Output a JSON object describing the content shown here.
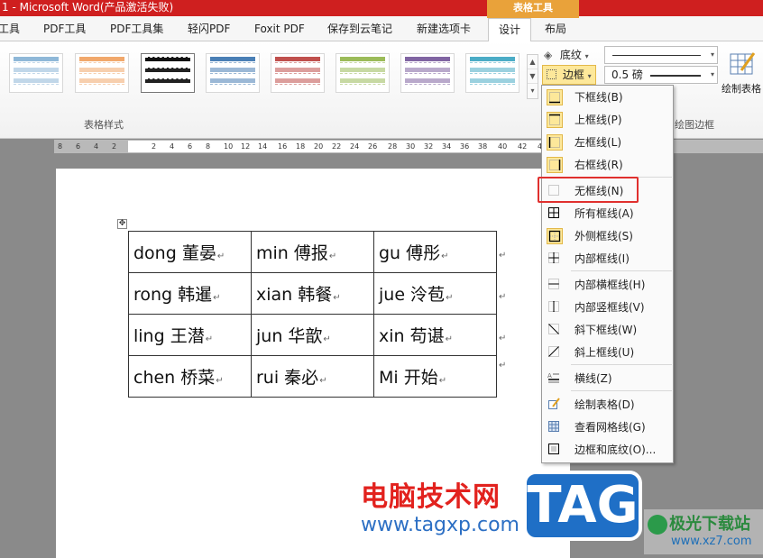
{
  "title": "1 - Microsoft Word(产品激活失败)",
  "context_tab_group": "表格工具",
  "tabs": [
    {
      "label": "工具"
    },
    {
      "label": "PDF工具"
    },
    {
      "label": "PDF工具集"
    },
    {
      "label": "轻闪PDF"
    },
    {
      "label": "Foxit PDF"
    },
    {
      "label": "保存到云笔记"
    },
    {
      "label": "新建选项卡"
    },
    {
      "label": "设计",
      "active": true
    },
    {
      "label": "布局"
    }
  ],
  "ribbon": {
    "table_styles_group": "表格样式",
    "draw_borders_group": "绘图边框",
    "shading_label": "底纹",
    "borders_label": "边框",
    "line_weight": "0.5 磅",
    "draw_table_label": "绘制表格",
    "gallery_arrows": [
      "▲",
      "▼",
      "▾"
    ],
    "style_colors": [
      "#8fb8d8",
      "#f1a86c",
      "#111111",
      "#4a7fb5",
      "#c0504d",
      "#9bbb59",
      "#8064a2",
      "#4bacc6"
    ]
  },
  "ruler": {
    "numbers": [
      "8",
      "6",
      "4",
      "2",
      "2",
      "4",
      "6",
      "8",
      "10",
      "12",
      "14",
      "16",
      "18",
      "20",
      "22",
      "24",
      "26",
      "28",
      "30",
      "32",
      "34",
      "36",
      "38",
      "40",
      "42",
      "44"
    ]
  },
  "document": {
    "anchor_glyph": "✥",
    "cell_mark": "↵",
    "table": [
      [
        "dong 董晏",
        "min 傅报",
        "gu 傅彤"
      ],
      [
        "rong 韩暹",
        "xian 韩餐",
        "jue 泠苞"
      ],
      [
        "ling 王潜",
        "jun 华歆",
        "xin 苟谌"
      ],
      [
        "chen 桥菜",
        "rui 秦必",
        "Mi 开始"
      ]
    ]
  },
  "border_menu": {
    "items": [
      {
        "label": "下框线(B)",
        "icon": "bottom-border-icon"
      },
      {
        "label": "上框线(P)",
        "icon": "top-border-icon"
      },
      {
        "label": "左框线(L)",
        "icon": "left-border-icon"
      },
      {
        "label": "右框线(R)",
        "icon": "right-border-icon"
      },
      {
        "label": "无框线(N)",
        "icon": "no-border-icon"
      },
      {
        "label": "所有框线(A)",
        "icon": "all-borders-icon"
      },
      {
        "label": "外侧框线(S)",
        "icon": "outside-borders-icon"
      },
      {
        "label": "内部框线(I)",
        "icon": "inside-borders-icon"
      },
      {
        "label": "内部横框线(H)",
        "icon": "inside-horizontal-border-icon"
      },
      {
        "label": "内部竖框线(V)",
        "icon": "inside-vertical-border-icon"
      },
      {
        "label": "斜下框线(W)",
        "icon": "diagonal-down-border-icon"
      },
      {
        "label": "斜上框线(U)",
        "icon": "diagonal-up-border-icon"
      },
      {
        "label": "横线(Z)",
        "icon": "horizontal-line-icon"
      },
      {
        "label": "绘制表格(D)",
        "icon": "draw-table-icon"
      },
      {
        "label": "查看网格线(G)",
        "icon": "view-gridlines-icon"
      },
      {
        "label": "边框和底纹(O)...",
        "icon": "borders-and-shading-icon"
      }
    ]
  },
  "watermarks": {
    "site_name": "电脑技术网",
    "site_url": "www.tagxp.com",
    "tag_text": "TAG",
    "logo_name": "极光下载站",
    "logo_url": "www.xz7.com"
  }
}
